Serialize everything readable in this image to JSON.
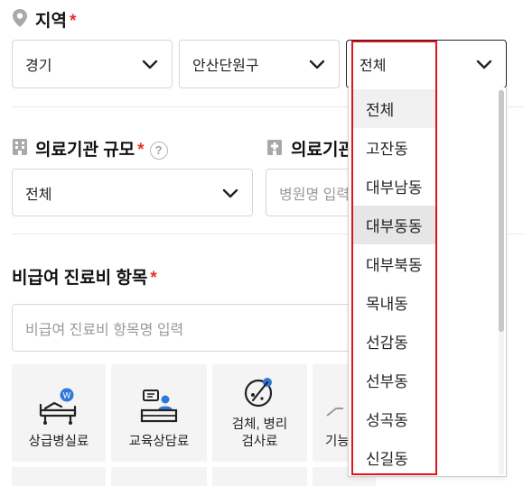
{
  "region": {
    "title": "지역",
    "required_mark": "*",
    "province": "경기",
    "city": "안산단원구",
    "dong": "전체"
  },
  "institution": {
    "size_title": "의료기관 규모",
    "size_required_mark": "*",
    "help_icon": "?",
    "size_value": "전체",
    "name_title": "의료기관",
    "name_placeholder": "병원명 입력"
  },
  "noncovered": {
    "title": "비급여 진료비 항목",
    "required_mark": "*",
    "placeholder": "비급여 진료비 항목명 입력",
    "tiles": [
      {
        "label": "상급병실료",
        "icon": "hospital-bed-icon"
      },
      {
        "label": "교육상담료",
        "icon": "counseling-desk-icon"
      },
      {
        "label": "검체, 병리\n검사료",
        "icon": "lab-test-icon"
      },
      {
        "label": "기능",
        "icon": "function-test-icon"
      }
    ]
  },
  "dropdown": {
    "options": [
      "전체",
      "고잔동",
      "대부남동",
      "대부동동",
      "대부북동",
      "목내동",
      "선감동",
      "선부동",
      "성곡동",
      "신길동"
    ],
    "hovered": "대부동동"
  },
  "colors": {
    "required": "#e5322d",
    "highlight_box": "#e1121b",
    "tile_bg": "#f4f4f4",
    "hover_bg": "#e6e6e6"
  }
}
